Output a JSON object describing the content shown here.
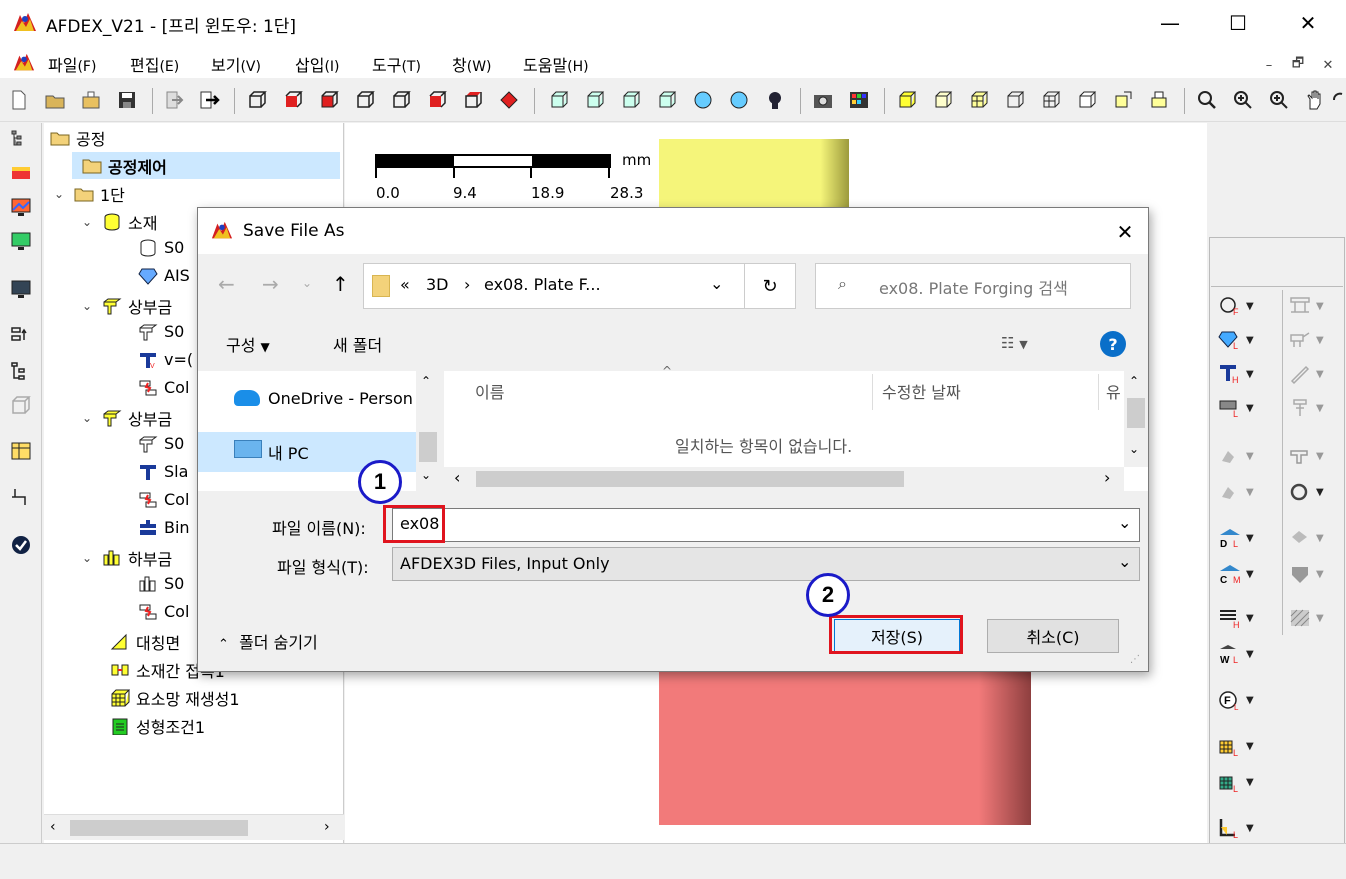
{
  "window": {
    "title": "AFDEX_V21 - [프리 윈도우: 1단]",
    "minimize": "—",
    "maximize": "☐",
    "close": "✕"
  },
  "menu": [
    {
      "label": "파일",
      "key": "(F)"
    },
    {
      "label": "편집",
      "key": "(E)"
    },
    {
      "label": "보기",
      "key": "(V)"
    },
    {
      "label": "삽입",
      "key": "(I)"
    },
    {
      "label": "도구",
      "key": "(T)"
    },
    {
      "label": "창",
      "key": "(W)"
    },
    {
      "label": "도움말",
      "key": "(H)"
    }
  ],
  "mdi": {
    "minimize": "–",
    "restore": "🗗",
    "close": "✕"
  },
  "tree": {
    "nodes": [
      {
        "label": "공정",
        "icon": "folder-open-icon"
      },
      {
        "label": "공정제어",
        "icon": "folder-icon"
      },
      {
        "label": "1단",
        "icon": "folder-open-icon"
      },
      {
        "label": "소재",
        "icon": "cylinder-icon"
      },
      {
        "label": "S0",
        "icon": "cylinder-outline-icon"
      },
      {
        "label": "AIS",
        "icon": "diamond-icon"
      },
      {
        "label": "상부금",
        "icon": "die-icon"
      },
      {
        "label": "S0",
        "icon": "die-outline-icon"
      },
      {
        "label": "v=(",
        "icon": "hammer-icon"
      },
      {
        "label": "Col",
        "icon": "collision-icon"
      },
      {
        "label": "상부금",
        "icon": "die-icon"
      },
      {
        "label": "S0",
        "icon": "die-outline-icon"
      },
      {
        "label": "Sla",
        "icon": "hammer-icon"
      },
      {
        "label": "Col",
        "icon": "collision-icon"
      },
      {
        "label": "Bin",
        "icon": "binder-icon"
      },
      {
        "label": "하부금",
        "icon": "lower-die-icon"
      },
      {
        "label": "S0",
        "icon": "lower-die-outline-icon"
      },
      {
        "label": "Col",
        "icon": "collision-icon"
      },
      {
        "label": "대칭면",
        "icon": "symmetry-icon"
      },
      {
        "label": "소재간 접촉1",
        "icon": "contact-icon"
      },
      {
        "label": "요소망 재생성1",
        "icon": "mesh-icon"
      },
      {
        "label": "성형조건1",
        "icon": "clipboard-icon"
      }
    ]
  },
  "scale": {
    "unit": "mm",
    "ticks": [
      "0.0",
      "9.4",
      "18.9",
      "28.3"
    ]
  },
  "colors": {
    "yellow_block": "#f5f57a",
    "red_block": "#f27a7a",
    "accent": "#0078d7",
    "highlight_red": "#e0141e",
    "callout_blue": "#1a1ac8"
  },
  "dialog": {
    "title": "Save File As",
    "close": "✕",
    "back": "←",
    "forward": "→",
    "up": "↑",
    "path_prefix": "«",
    "path_segments": [
      "3D",
      "ex08. Plate F..."
    ],
    "path_sep": "›",
    "search_placeholder": "ex08. Plate Forging 검색",
    "organize": "구성",
    "new_folder": "새 폴더",
    "help": "?",
    "nav_items": [
      {
        "label": "OneDrive - Person",
        "icon": "cloud-icon"
      },
      {
        "label": "내 PC",
        "icon": "pc-icon"
      }
    ],
    "columns": [
      "이름",
      "수정한 날짜",
      "유"
    ],
    "empty_message": "일치하는 항목이 없습니다.",
    "filename_label": "파일 이름(N):",
    "filename_value": "ex08",
    "filetype_label": "파일 형식(T):",
    "filetype_value": "AFDEX3D Files, Input Only",
    "hide_folders": "폴더 숨기기",
    "save": "저장(S)",
    "cancel": "취소(C)"
  },
  "callouts": [
    "1",
    "2"
  ]
}
